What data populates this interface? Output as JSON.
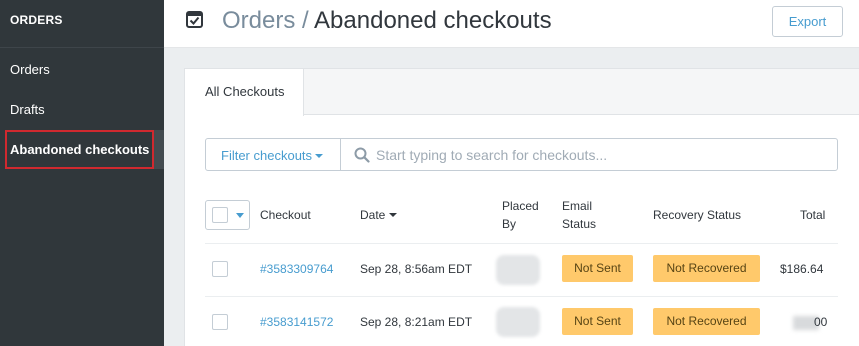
{
  "sidebar": {
    "header": "ORDERS",
    "items": [
      {
        "label": "Orders"
      },
      {
        "label": "Drafts"
      },
      {
        "label": "Abandoned checkouts"
      }
    ]
  },
  "header": {
    "icon": "checkbox-icon",
    "breadcrumb_parent": "Orders",
    "breadcrumb_sep": " / ",
    "title": "Abandoned checkouts",
    "export_label": "Export"
  },
  "tabs": [
    {
      "label": "All Checkouts"
    }
  ],
  "filter": {
    "label": "Filter checkouts",
    "search_placeholder": "Start typing to search for checkouts..."
  },
  "table": {
    "columns": {
      "checkout": "Checkout",
      "date": "Date",
      "placed_by_line1": "Placed",
      "placed_by_line2": "By",
      "email_status_line1": "Email",
      "email_status_line2": "Status",
      "recovery_status": "Recovery Status",
      "total": "Total"
    },
    "rows": [
      {
        "checkout": "#3583309764",
        "date": "Sep 28, 8:56am EDT",
        "email_status": "Not Sent",
        "recovery_status": "Not Recovered",
        "total": "$186.64"
      },
      {
        "checkout": "#3583141572",
        "date": "Sep 28, 8:21am EDT",
        "email_status": "Not Sent",
        "recovery_status": "Not Recovered",
        "total": "00"
      }
    ]
  },
  "colors": {
    "sidebar_bg": "#30373b",
    "accent": "#479ccf",
    "badge": "#ffc96b",
    "highlight": "#d0292f"
  }
}
